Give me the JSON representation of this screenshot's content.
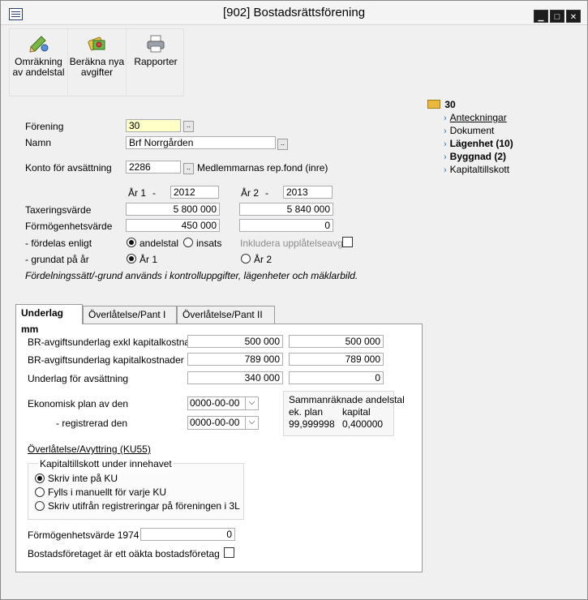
{
  "window": {
    "title": "[902]  Bostadsrättsförening",
    "minimize": "▁",
    "maximize": "□",
    "close": "✕"
  },
  "toolbar": [
    {
      "label": "Omräkning av andelstal",
      "icon": "recalc-pencil-icon"
    },
    {
      "label": "Beräkna nya avgifter",
      "icon": "money-calc-icon"
    },
    {
      "label": "Rapporter",
      "icon": "printer-icon"
    }
  ],
  "tree": {
    "root": "30",
    "items": [
      "Anteckningar",
      "Dokument",
      "Lägenhet (10)",
      "Byggnad (2)",
      "Kapitaltillskott"
    ]
  },
  "form": {
    "forening_label": "Förening",
    "forening_value": "30",
    "namn_label": "Namn",
    "namn_value": "Brf Norrgården",
    "konto_label": "Konto för avsättning",
    "konto_value": "2286",
    "konto_desc": "Medlemmarnas rep.fond (inre)",
    "ar1_label": "År 1",
    "ar1_dash": "-",
    "ar1_value": "2012",
    "ar2_label": "År 2",
    "ar2_dash": "-",
    "ar2_value": "2013",
    "tax_label": "Taxeringsvärde",
    "tax1": "5 800 000",
    "tax2": "5 840 000",
    "form_label": "Förmögenhetsvärde",
    "form1": "450 000",
    "form2": "0",
    "fordelas_label": "- fördelas enligt",
    "opt_andelstal": "andelstal",
    "opt_insats": "insats",
    "inkludera_label": "Inkludera upplåtelseavgift",
    "grundat_label": "- grundat på år",
    "opt_ar1": "År 1",
    "opt_ar2": "År 2",
    "note": "Fördelningssätt/-grund används i kontrolluppgifter, lägenheter och mäklarbild."
  },
  "tabs": [
    "Underlag mm",
    "Överlåtelse/Pant I",
    "Överlåtelse/Pant II"
  ],
  "panel": {
    "br_exkl_label": "BR-avgiftsunderlag exkl kapitalkostnader",
    "br_exkl_1": "500 000",
    "br_exkl_2": "500 000",
    "br_kap_label": "BR-avgiftsunderlag kapitalkostnader",
    "br_kap_1": "789 000",
    "br_kap_2": "789 000",
    "avs_label": "Underlag för avsättning",
    "avs_1": "340 000",
    "avs_2": "0",
    "plan_label": "Ekonomisk plan av den",
    "plan_value": "0000-00-00",
    "reg_label": "- registrerad den",
    "reg_value": "0000-00-00",
    "samman_title": "Sammanräknade andelstal",
    "samman_col1": "ek. plan",
    "samman_col2": "kapital",
    "samman_val1": "99,999998",
    "samman_val2": "0,400000",
    "ku55_label": "Överlåtelse/Avyttring (KU55)",
    "kap_group": "Kapitaltillskott under innehavet",
    "kap_opt1": "Skriv inte på KU",
    "kap_opt2": "Fylls i manuellt för varje KU",
    "kap_opt3": "Skriv utifrån registreringar på föreningen i 3L",
    "f1974_label": "Förmögenhetsvärde 1974",
    "f1974_value": "0",
    "oakta_label": "Bostadsföretaget är ett oäkta bostadsföretag"
  }
}
